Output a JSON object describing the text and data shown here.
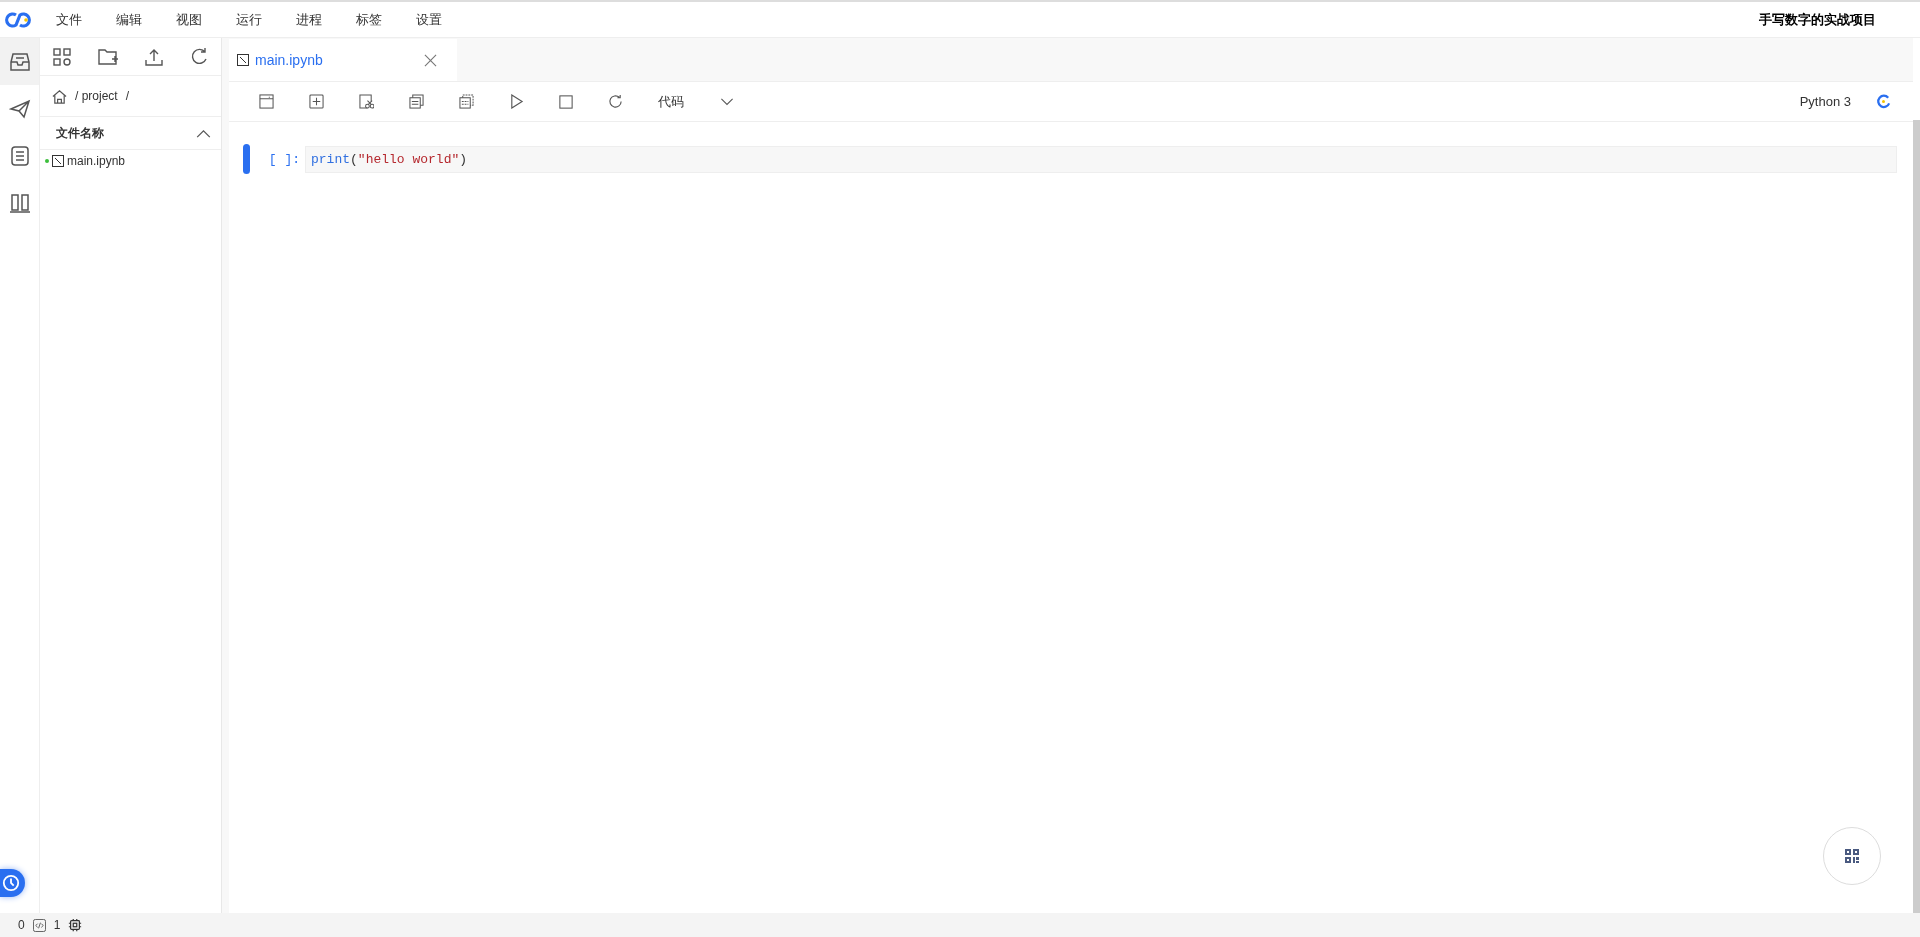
{
  "menu": [
    "文件",
    "编辑",
    "视图",
    "运行",
    "进程",
    "标签",
    "设置"
  ],
  "project_title": "手写数字的实战项目",
  "activity_bar": [
    {
      "kind": "inbox",
      "selected": true
    },
    {
      "kind": "send",
      "selected": false
    },
    {
      "kind": "list",
      "selected": false
    },
    {
      "kind": "columns",
      "selected": false
    }
  ],
  "file_panel": {
    "breadcrumb": [
      "/ project",
      "/"
    ],
    "header": "文件名称",
    "files": [
      {
        "name": "main.ipynb",
        "running": true
      }
    ]
  },
  "tabs": [
    {
      "label": "main.ipynb",
      "selected": true
    }
  ],
  "toolbar": {
    "cell_type": "代码",
    "kernel": "Python 3"
  },
  "cells": [
    {
      "selected": true,
      "prompt": "[ ]:",
      "code": [
        {
          "text": "print",
          "kind": "builtin"
        },
        {
          "text": "(",
          "kind": "punct"
        },
        {
          "text": "\"hello world\"",
          "kind": "string"
        },
        {
          "text": ")",
          "kind": "punct"
        }
      ]
    }
  ],
  "status_bar": {
    "count_1": "0",
    "count_2": "1"
  }
}
